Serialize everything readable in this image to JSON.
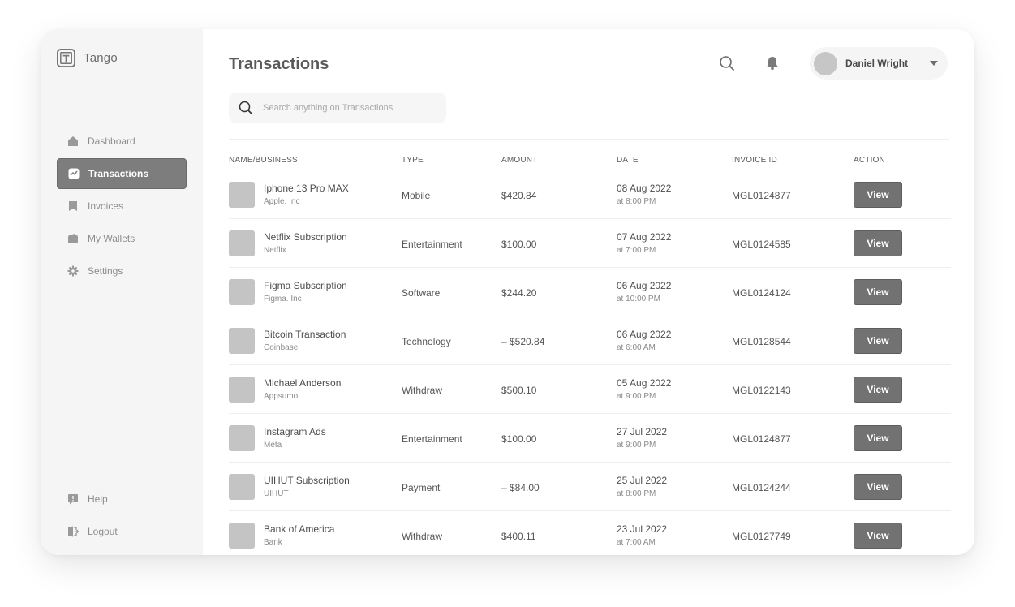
{
  "app": {
    "name": "Tango"
  },
  "sidebar": {
    "items": [
      {
        "label": "Dashboard",
        "icon": "home-icon",
        "active": false
      },
      {
        "label": "Transactions",
        "icon": "chart-icon",
        "active": true
      },
      {
        "label": "Invoices",
        "icon": "invoice-icon",
        "active": false
      },
      {
        "label": "My Wallets",
        "icon": "wallet-icon",
        "active": false
      },
      {
        "label": "Settings",
        "icon": "gear-icon",
        "active": false
      }
    ],
    "bottom": [
      {
        "label": "Help",
        "icon": "help-icon"
      },
      {
        "label": "Logout",
        "icon": "logout-icon"
      }
    ]
  },
  "header": {
    "title": "Transactions",
    "user_name": "Daniel Wright",
    "search_placeholder": "Search anything on Transactions"
  },
  "table": {
    "columns": [
      "NAME/BUSINESS",
      "TYPE",
      "AMOUNT",
      "DATE",
      "INVOICE ID",
      "ACTION"
    ],
    "rows": [
      {
        "name": "Iphone 13 Pro MAX",
        "business": "Apple. Inc",
        "type": "Mobile",
        "amount": "$420.84",
        "date": "08 Aug 2022",
        "time": "at 8:00 PM",
        "invoice": "MGL0124877",
        "action": "View"
      },
      {
        "name": "Netflix Subscription",
        "business": "Netflix",
        "type": "Entertainment",
        "amount": "$100.00",
        "date": "07 Aug 2022",
        "time": "at 7:00 PM",
        "invoice": "MGL0124585",
        "action": "View"
      },
      {
        "name": "Figma Subscription",
        "business": "Figma. Inc",
        "type": "Software",
        "amount": "$244.20",
        "date": "06 Aug 2022",
        "time": "at 10:00 PM",
        "invoice": "MGL0124124",
        "action": "View"
      },
      {
        "name": "Bitcoin Transaction",
        "business": "Coinbase",
        "type": "Technology",
        "amount": "– $520.84",
        "date": "06 Aug 2022",
        "time": "at 6:00 AM",
        "invoice": "MGL0128544",
        "action": "View"
      },
      {
        "name": "Michael Anderson",
        "business": "Appsumo",
        "type": "Withdraw",
        "amount": "$500.10",
        "date": "05 Aug 2022",
        "time": "at 9:00 PM",
        "invoice": "MGL0122143",
        "action": "View"
      },
      {
        "name": "Instagram Ads",
        "business": "Meta",
        "type": "Entertainment",
        "amount": "$100.00",
        "date": "27 Jul 2022",
        "time": "at 9:00 PM",
        "invoice": "MGL0124877",
        "action": "View"
      },
      {
        "name": "UIHUT Subscription",
        "business": "UIHUT",
        "type": "Payment",
        "amount": "– $84.00",
        "date": "25 Jul 2022",
        "time": "at 8:00 PM",
        "invoice": "MGL0124244",
        "action": "View"
      },
      {
        "name": "Bank of America",
        "business": "Bank",
        "type": "Withdraw",
        "amount": "$400.11",
        "date": "23 Jul 2022",
        "time": "at 7:00 AM",
        "invoice": "MGL0127749",
        "action": "View"
      }
    ]
  }
}
